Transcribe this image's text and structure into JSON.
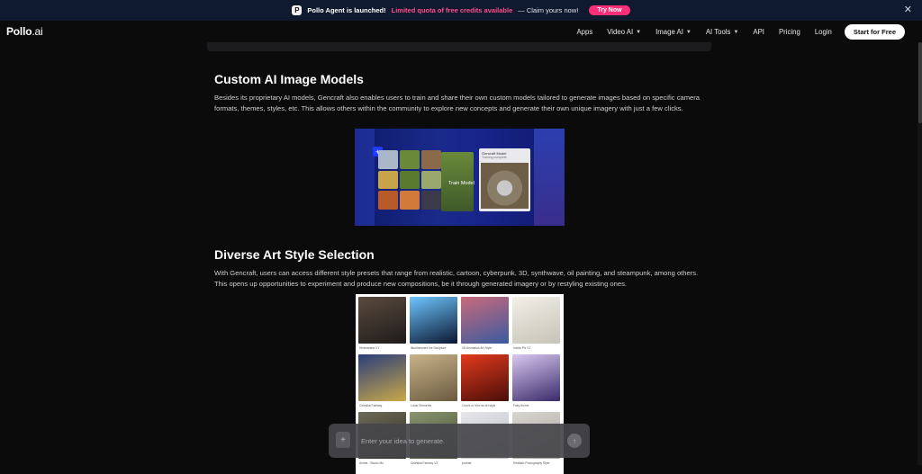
{
  "announcement": {
    "logo_text": "P",
    "title": "Pollo Agent is launched!",
    "highlight": "Limited quota of free credits available",
    "rest": "— Claim yours now!",
    "button": "Try Now",
    "close": "✕"
  },
  "navbar": {
    "brand_main": "Pollo",
    "brand_suffix": ".ai",
    "items": [
      {
        "label": "Apps",
        "dropdown": false
      },
      {
        "label": "Video AI",
        "dropdown": true
      },
      {
        "label": "Image AI",
        "dropdown": true
      },
      {
        "label": "AI Tools",
        "dropdown": true
      },
      {
        "label": "API",
        "dropdown": false
      },
      {
        "label": "Pricing",
        "dropdown": false
      },
      {
        "label": "Login",
        "dropdown": false
      }
    ],
    "cta": "Start for Free"
  },
  "section1": {
    "heading": "Custom AI Image Models",
    "body": "Besides its proprietary AI models, Gencraft also enables users to train and share their own custom models tailored to generate images based on specific camera formats, themes, styles, etc. This allows others within the community to explore new concepts and generate their own unique imagery with just a few clicks.",
    "image": {
      "plus": "+",
      "train_label": "Train Model",
      "card_title": "Gencraft Model",
      "card_sub": "Training complete"
    }
  },
  "section2": {
    "heading": "Diverse Art Style Selection",
    "body": "With Gencraft, users can access different style presets that range from realistic, cartoon, cyberpunk, 3D, synthwave, oil painting, and steampunk, among others. This opens up opportunities to experiment and produce new compositions, be it through generated imagery or by restyling existing ones.",
    "styles": [
      {
        "caption": "Hinterarena V1",
        "c1": "#5a4a3e",
        "c2": "#1e1b1a"
      },
      {
        "caption": "Illuminescent Ice Sculpture",
        "c1": "#6ec6ff",
        "c2": "#0a1630"
      },
      {
        "caption": "3D Animation Art Style",
        "c1": "#c96a7a",
        "c2": "#3a5aa0"
      },
      {
        "caption": "Inside Pix V1",
        "c1": "#f1efe6",
        "c2": "#c6c4b8"
      },
      {
        "caption": "Celestial Fantasy",
        "c1": "#2a3d7a",
        "c2": "#c9a84a"
      },
      {
        "caption": "Lunar Elements",
        "c1": "#c8b48a",
        "c2": "#6a5a3e"
      },
      {
        "caption": "Comic or Vice as art style",
        "c1": "#e33a1e",
        "c2": "#4a0e08"
      },
      {
        "caption": "Fairy Anime",
        "c1": "#d9c8f0",
        "c2": "#3a2a6a"
      },
      {
        "caption": "Anime - Studio Mo",
        "c1": "#6e6a58",
        "c2": "#2a2a22"
      },
      {
        "caption": "Celestial Fantasy V2",
        "c1": "#8a9470",
        "c2": "#3e4a2e"
      },
      {
        "caption": "portrait",
        "c1": "#e6e6ea",
        "c2": "#b8bcc4"
      },
      {
        "caption": "Realistic Photography Style",
        "c1": "#d8d6d0",
        "c2": "#a6a39a"
      }
    ]
  },
  "prompt": {
    "plus": "+",
    "placeholder": "Enter your idea to generate.",
    "send": "↑"
  },
  "colors": {
    "accent": "#ff2e78",
    "highlight": "#ff4d8d",
    "background": "#0b0b0c",
    "announce_bg": "#101a2e"
  }
}
